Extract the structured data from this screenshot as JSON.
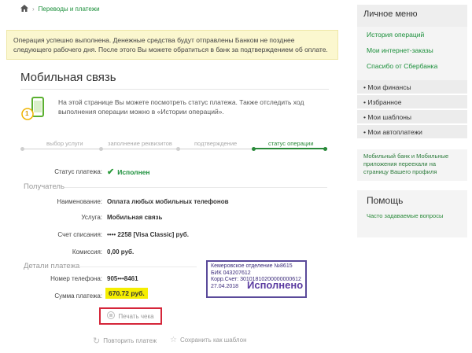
{
  "breadcrumb": {
    "items": [
      "Переводы и платежи"
    ]
  },
  "notice": {
    "text": "Операция успешно выполнена. Денежные средства будут отправлены Банком не позднее следующего рабочего дня. После этого Вы можете обратиться в банк за подтверждением об оплате."
  },
  "page": {
    "title": "Мобильная связь",
    "info_text": "На этой странице Вы можете посмотреть статус платежа. Также отследить ход выполнения операции можно в «Истории операций».",
    "phone_badge": "1"
  },
  "steps": [
    "выбор услуги",
    "заполнение реквизитов",
    "подтверждение",
    "статус операции"
  ],
  "status": {
    "label": "Статус платежа:",
    "value": "Исполнен"
  },
  "recipient": {
    "heading": "Получатель",
    "rows": [
      {
        "label": "Наименование:",
        "value": "Оплата любых мобильных телефонов"
      },
      {
        "label": "Услуга:",
        "value": "Мобильная связь"
      },
      {
        "label": "Счет списания:",
        "value": "•••• 2258  [Visa Classic]  руб."
      },
      {
        "label": "Комиссия:",
        "value": "0,00 руб."
      }
    ]
  },
  "details": {
    "heading": "Детали платежа",
    "phone_label": "Номер телефона:",
    "phone_value": "905•••8461",
    "sum_label": "Сумма платежа:",
    "sum_value": "670.72 руб."
  },
  "stamp": {
    "line1": "Кемеровское отделение №8615",
    "line2": "БИК 043207612",
    "line3": "Корр.Счет: 30101810200000000612",
    "line4": "27.04.2018",
    "big": "Исполнено"
  },
  "actions": {
    "print": "Печать чека",
    "repeat": "Повторить платеж",
    "save_template": "Сохранить как шаблон"
  },
  "sidebar": {
    "title": "Личное меню",
    "links": [
      "История операций",
      "Мои интернет-заказы",
      "Спасибо от Сбербанка"
    ],
    "categories": [
      "Мои финансы",
      "Избранное",
      "Мои шаблоны",
      "Мои автоплатежи"
    ],
    "promo": "Мобильный банк и Мобильные приложения переехали на страницу Вашего профиля",
    "help_title": "Помощь",
    "help_link": "Часто задаваемые вопросы"
  },
  "colors": {
    "accent": "#1a8f3a",
    "notice_bg": "#fbf7cf",
    "highlight": "#f5ee00",
    "print_border": "#d5263a",
    "stamp": "#5a3aa0"
  }
}
